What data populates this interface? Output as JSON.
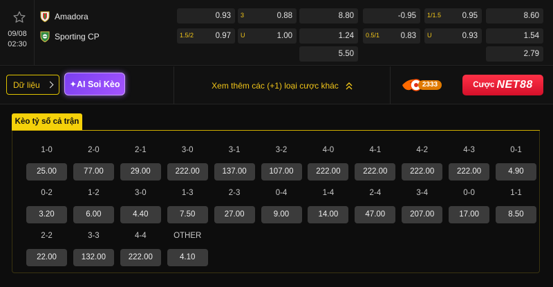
{
  "match": {
    "date": "09/08",
    "time": "02:30",
    "home": "Amadora",
    "away": "Sporting CP",
    "odds_left": [
      [
        {
          "label": "",
          "value": "0.93"
        },
        {
          "label": "3",
          "value": "0.88"
        },
        {
          "label": "",
          "value": "8.80"
        }
      ],
      [
        {
          "label": "1.5/2",
          "value": "0.97"
        },
        {
          "label": "U",
          "value": "1.00"
        },
        {
          "label": "",
          "value": "1.24"
        }
      ],
      [
        null,
        null,
        {
          "label": "",
          "value": "5.50"
        }
      ]
    ],
    "odds_right": [
      [
        {
          "label": "",
          "value": "-0.95"
        },
        {
          "label": "1/1.5",
          "value": "0.95"
        },
        {
          "label": "",
          "value": "8.60"
        }
      ],
      [
        {
          "label": "0.5/1",
          "value": "0.83"
        },
        {
          "label": "U",
          "value": "0.93"
        },
        {
          "label": "",
          "value": "1.54"
        }
      ],
      [
        null,
        null,
        {
          "label": "",
          "value": "2.79"
        }
      ]
    ]
  },
  "actions": {
    "data_label": "Dữ liệu",
    "ai_label": "✦AI Soi Kèo",
    "more_label": "Xem thêm các (+1) loại cược khác",
    "promo_badge": "2333",
    "brand_prefix": "Cược",
    "brand_name": "NET88"
  },
  "section": {
    "tab_label": "Kèo tỷ số cả trận"
  },
  "scores": [
    [
      {
        "s": "1-0",
        "o": "25.00"
      },
      {
        "s": "2-0",
        "o": "77.00"
      },
      {
        "s": "2-1",
        "o": "29.00"
      },
      {
        "s": "3-0",
        "o": "222.00"
      },
      {
        "s": "3-1",
        "o": "137.00"
      },
      {
        "s": "3-2",
        "o": "107.00"
      },
      {
        "s": "4-0",
        "o": "222.00"
      },
      {
        "s": "4-1",
        "o": "222.00"
      },
      {
        "s": "4-2",
        "o": "222.00"
      },
      {
        "s": "4-3",
        "o": "222.00"
      },
      {
        "s": "0-1",
        "o": "4.90"
      }
    ],
    [
      {
        "s": "0-2",
        "o": "3.20"
      },
      {
        "s": "1-2",
        "o": "6.00"
      },
      {
        "s": "3-0",
        "o": "4.40"
      },
      {
        "s": "1-3",
        "o": "7.50"
      },
      {
        "s": "2-3",
        "o": "27.00"
      },
      {
        "s": "0-4",
        "o": "9.00"
      },
      {
        "s": "1-4",
        "o": "14.00"
      },
      {
        "s": "2-4",
        "o": "47.00"
      },
      {
        "s": "3-4",
        "o": "207.00"
      },
      {
        "s": "0-0",
        "o": "17.00"
      },
      {
        "s": "1-1",
        "o": "8.50"
      }
    ],
    [
      {
        "s": "2-2",
        "o": "22.00"
      },
      {
        "s": "3-3",
        "o": "132.00"
      },
      {
        "s": "4-4",
        "o": "222.00"
      },
      {
        "s": "OTHER",
        "o": "4.10"
      }
    ]
  ],
  "colors": {
    "accent": "#f5d10a",
    "ai_purple": "#8a48f6",
    "brand_red": "#e81a32"
  }
}
